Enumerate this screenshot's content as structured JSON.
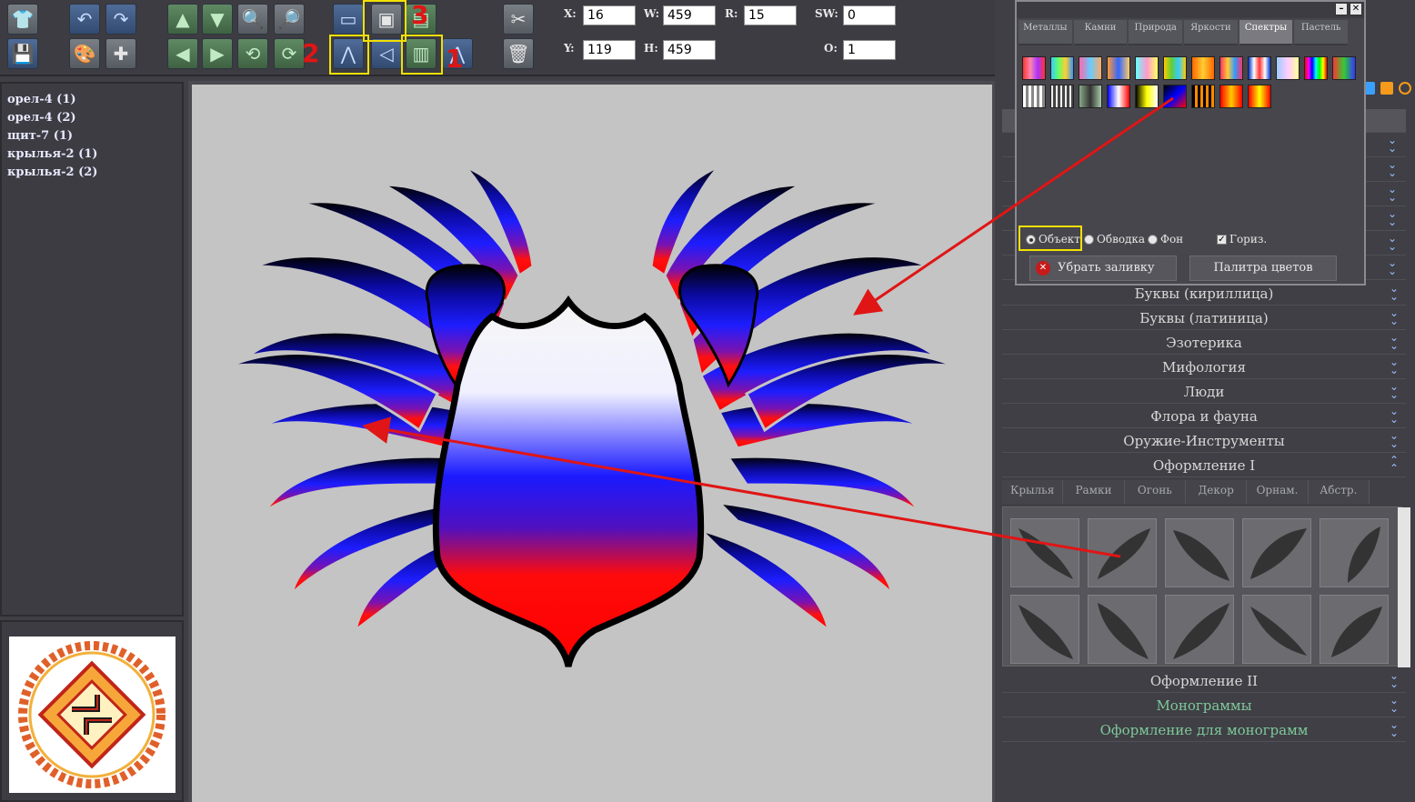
{
  "toolbar": {
    "x_label": "X:",
    "x_value": "16",
    "y_label": "Y:",
    "y_value": "119",
    "w_label": "W:",
    "w_value": "459",
    "h_label": "H:",
    "h_value": "459",
    "r_label": "R:",
    "r_value": "15",
    "sw_label": "SW:",
    "sw_value": "0",
    "o_label": "O:",
    "o_value": "1",
    "marker_1": "1",
    "marker_2": "2",
    "marker_3": "3"
  },
  "layers": [
    "орел-4 (1)",
    "орел-4 (2)",
    "щит-7 (1)",
    "крылья-2 (1)",
    "крылья-2 (2)"
  ],
  "color_dialog": {
    "tabs": [
      "Металлы",
      "Камни",
      "Природа",
      "Яркости",
      "Спектры",
      "Пастель"
    ],
    "active_tab": "Спектры",
    "radio_object": "Объект",
    "radio_outline": "Обводка",
    "radio_background": "Фон",
    "check_horizontal": "Гориз.",
    "remove_fill_button": "Убрать заливку",
    "palette_button": "Палитра цветов"
  },
  "library": {
    "categories": [
      "Буквы (кириллица)",
      "Буквы (латиница)",
      "Эзотерика",
      "Мифология",
      "Люди",
      "Флора и фауна",
      "Оружие-Инструменты",
      "Оформление I"
    ],
    "sub_tabs": [
      "Крылья",
      "Рамки",
      "Огонь",
      "Декор",
      "Орнам.",
      "Абстр."
    ],
    "bottom_categories": [
      "Оформление II",
      "Монограммы",
      "Оформление для монограмм"
    ]
  },
  "colors": {
    "highlight": "#f2e000",
    "arrow": "#e01515",
    "canvas": "#c4c4c4"
  }
}
